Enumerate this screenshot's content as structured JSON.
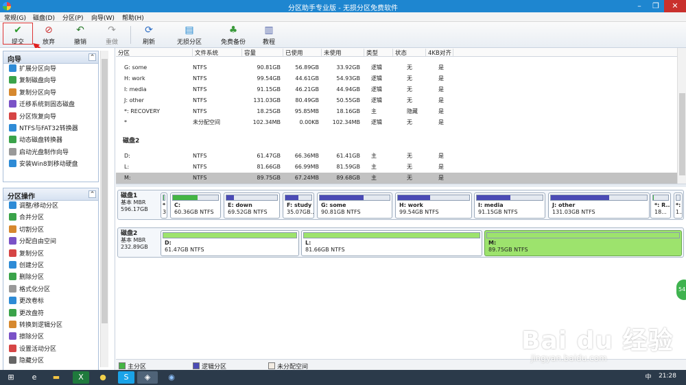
{
  "window": {
    "title": "分区助手专业版 - 无损分区免费软件",
    "minimize": "–",
    "restore": "❐",
    "close": "✕"
  },
  "menu": [
    "常规(G)",
    "磁盘(D)",
    "分区(P)",
    "向导(W)",
    "帮助(H)"
  ],
  "toolbar": {
    "submit": "提交",
    "discard": "放弃",
    "undo": "撤销",
    "redo": "重做",
    "refresh": "刷新",
    "lossless": "无损分区",
    "backup": "免费备份",
    "tutorial": "教程"
  },
  "wizard_panel": {
    "title": "向导",
    "collapse": "^",
    "items": [
      "扩展分区向导",
      "复制磁盘向导",
      "复制分区向导",
      "迁移系统到固态磁盘",
      "分区恢复向导",
      "NTFS与FAT32转换器",
      "动态磁盘转换器",
      "启动光盘制作向导",
      "安装Win8到移动硬盘"
    ]
  },
  "ops_panel": {
    "title": "分区操作",
    "collapse": "^",
    "items": [
      "调整/移动分区",
      "合并分区",
      "切割分区",
      "分配自由空间",
      "复制分区",
      "创建分区",
      "删除分区",
      "格式化分区",
      "更改卷标",
      "更改盘符",
      "转换到逻辑分区",
      "擦除分区",
      "设置活动分区",
      "隐藏分区"
    ]
  },
  "table": {
    "headers": [
      "分区",
      "文件系统",
      "容量",
      "已使用",
      "未使用",
      "类型",
      "状态",
      "4KB对齐"
    ],
    "disk1_rows": [
      [
        "G: some",
        "NTFS",
        "90.81GB",
        "56.89GB",
        "33.92GB",
        "逻辑",
        "无",
        "是"
      ],
      [
        "H: work",
        "NTFS",
        "99.54GB",
        "44.61GB",
        "54.93GB",
        "逻辑",
        "无",
        "是"
      ],
      [
        "I: media",
        "NTFS",
        "91.15GB",
        "46.21GB",
        "44.94GB",
        "逻辑",
        "无",
        "是"
      ],
      [
        "J: other",
        "NTFS",
        "131.03GB",
        "80.49GB",
        "50.55GB",
        "逻辑",
        "无",
        "是"
      ],
      [
        "*: RECOVERY",
        "NTFS",
        "18.25GB",
        "95.85MB",
        "18.16GB",
        "主",
        "隐藏",
        "是"
      ],
      [
        "*",
        "未分配空间",
        "102.34MB",
        "0.00KB",
        "102.34MB",
        "逻辑",
        "无",
        "是"
      ]
    ],
    "disk2_label": "磁盘2",
    "disk2_rows": [
      [
        "D:",
        "NTFS",
        "61.47GB",
        "66.36MB",
        "61.41GB",
        "主",
        "无",
        "是"
      ],
      [
        "L:",
        "NTFS",
        "81.66GB",
        "66.99MB",
        "81.59GB",
        "主",
        "无",
        "是"
      ],
      [
        "M:",
        "NTFS",
        "89.75GB",
        "67.24MB",
        "89.68GB",
        "主",
        "无",
        "是"
      ]
    ]
  },
  "disk1": {
    "name": "磁盘1",
    "type": "基本 MBR",
    "size": "596.17GB",
    "parts": [
      {
        "name": "*",
        "size": "3",
        "fill": 0.5
      },
      {
        "name": "C:",
        "size": "60.36GB NTFS",
        "fill": 0.55
      },
      {
        "name": "E: down",
        "size": "69.52GB NTFS",
        "fill": 0.15
      },
      {
        "name": "F: study",
        "size": "35.07GB...",
        "fill": 0.5
      },
      {
        "name": "G: some",
        "size": "90.81GB NTFS",
        "fill": 0.63
      },
      {
        "name": "H: work",
        "size": "99.54GB NTFS",
        "fill": 0.45
      },
      {
        "name": "I: media",
        "size": "91.15GB NTFS",
        "fill": 0.51
      },
      {
        "name": "J: other",
        "size": "131.03GB NTFS",
        "fill": 0.61
      },
      {
        "name": "*: R...",
        "size": "18...",
        "fill": 0.05
      },
      {
        "name": "*:",
        "size": "1...",
        "fill": 0
      }
    ]
  },
  "disk2": {
    "name": "磁盘2",
    "type": "基本 MBR",
    "size": "232.89GB",
    "parts": [
      {
        "name": "D:",
        "size": "61.47GB NTFS",
        "fill": 0.01
      },
      {
        "name": "L:",
        "size": "81.66GB NTFS",
        "fill": 0.01
      },
      {
        "name": "M:",
        "size": "89.75GB NTFS",
        "fill": 0.01
      }
    ]
  },
  "legend": {
    "primary": "主分区",
    "logical": "逻辑分区",
    "unalloc": "未分配空间"
  },
  "colors": {
    "primary": "#44b544",
    "logical": "#4b4bb5",
    "unalloc": "#f3ece3",
    "selected": "#c2c2c2",
    "titlebar": "#1e86d0"
  },
  "taskbar": {
    "time": "21:28",
    "ime": "中"
  },
  "watermark": {
    "brand": "Bai du 经验",
    "url": "jingyan.baidu.com"
  },
  "side_badge": "54"
}
